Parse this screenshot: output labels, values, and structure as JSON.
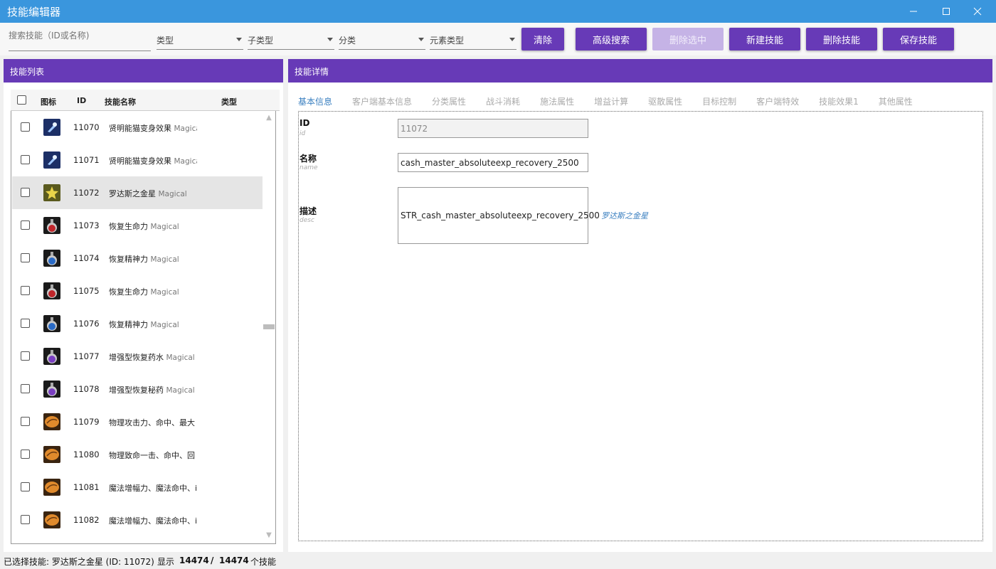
{
  "window": {
    "title": "技能编辑器",
    "minimize_icon": "minimize-icon",
    "maximize_icon": "maximize-icon",
    "close_icon": "close-icon"
  },
  "toolbar": {
    "search_placeholder": "搜索技能（ID或名称)",
    "filters": [
      "类型",
      "子类型",
      "分类",
      "元素类型"
    ],
    "buttons": {
      "clear": "清除",
      "advanced_search": "高级搜索",
      "delete_selected": "删除选中",
      "new_skill": "新建技能",
      "delete_skill": "删除技能",
      "save_skill": "保存技能"
    }
  },
  "left_panel": {
    "title": "技能列表",
    "columns": {
      "icon": "图标",
      "id": "ID",
      "name": "技能名称",
      "type": "类型"
    },
    "rows": [
      {
        "id": "11070",
        "name": "贤明能猫变身效果",
        "type": "Magical",
        "icon": "spell-blue-icon"
      },
      {
        "id": "11071",
        "name": "贤明能猫变身效果",
        "type": "Magical",
        "icon": "spell-blue-icon"
      },
      {
        "id": "11072",
        "name": "罗达斯之金星",
        "type": "Magical",
        "icon": "star-gold-icon",
        "selected": true
      },
      {
        "id": "11073",
        "name": "恢复生命力",
        "type": "Magical",
        "icon": "potion-red-icon"
      },
      {
        "id": "11074",
        "name": "恢复精神力",
        "type": "Magical",
        "icon": "potion-blue-icon"
      },
      {
        "id": "11075",
        "name": "恢复生命力",
        "type": "Magical",
        "icon": "potion-red-icon"
      },
      {
        "id": "11076",
        "name": "恢复精神力",
        "type": "Magical",
        "icon": "potion-blue-icon"
      },
      {
        "id": "11077",
        "name": "增强型恢复药水",
        "type": "Magical",
        "icon": "potion-purple-icon"
      },
      {
        "id": "11078",
        "name": "增强型恢复秘药",
        "type": "Magical",
        "icon": "potion-purple-icon"
      },
      {
        "id": "11079",
        "name": "物理攻击力、命中、最大",
        "type": "Magical",
        "icon": "scroll-orange-icon"
      },
      {
        "id": "11080",
        "name": "物理致命一击、命中、回",
        "type": "Magical",
        "icon": "scroll-orange-icon"
      },
      {
        "id": "11081",
        "name": "魔法增幅力、魔法命中、i",
        "type": "Magical",
        "icon": "scroll-orange-icon"
      },
      {
        "id": "11082",
        "name": "魔法增幅力、魔法命中、i",
        "type": "Magical",
        "icon": "scroll-orange-icon"
      }
    ]
  },
  "right_panel": {
    "title": "技能详情",
    "tabs": [
      "基本信息",
      "客户端基本信息",
      "分类属性",
      "战斗消耗",
      "施法属性",
      "增益计算",
      "驱散属性",
      "目标控制",
      "客户端特效",
      "技能效果1",
      "其他属性"
    ],
    "active_tab": "基本信息",
    "fields": {
      "id_label": "ID",
      "id_sub": "id",
      "id_value": "11072",
      "name_label": "名称",
      "name_sub": "name",
      "name_value": "cash_master_absoluteexp_recovery_2500",
      "desc_label": "描述",
      "desc_sub": "desc",
      "desc_value": "STR_cash_master_absoluteexp_recovery_2500",
      "desc_hint": "罗达斯之金星"
    }
  },
  "status": {
    "selected_text": "已选择技能: 罗达斯之金星 (ID: 11072)",
    "show_label": "显示",
    "shown": "14474",
    "sep": "/",
    "total": "14474",
    "suffix": "个技能"
  },
  "colors": {
    "titlebar": "#3a96dd",
    "accent": "#673ab7",
    "tab_active": "#3a7fc0"
  }
}
